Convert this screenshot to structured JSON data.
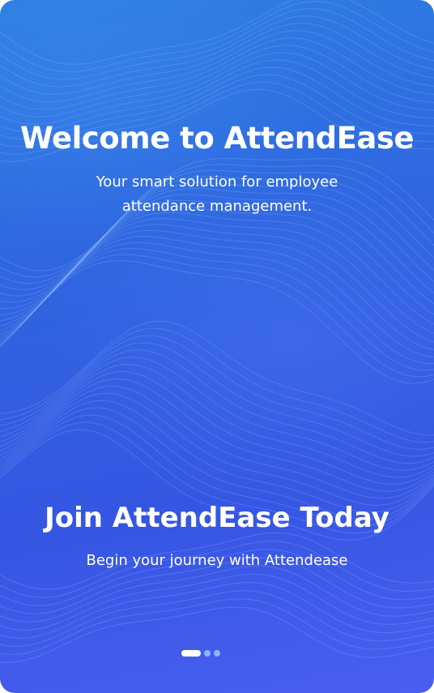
{
  "welcome": {
    "title": "Welcome to AttendEase",
    "subtitle": "Your smart solution for employee attendance management."
  },
  "join": {
    "title": "Join AttendEase Today",
    "subtitle": "Begin your journey with Attendease"
  },
  "pager": {
    "total": 3,
    "active_index": 0
  },
  "colors": {
    "background_top": "#2f7fe3",
    "background_bottom": "#4a5ef0",
    "text": "#ffffff",
    "dot_inactive": "#8fb4ff"
  }
}
